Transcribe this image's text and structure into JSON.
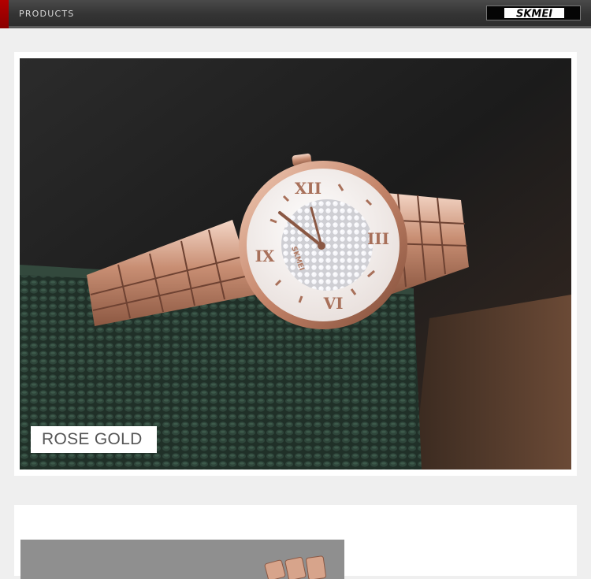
{
  "header": {
    "title": "PRODUCTS",
    "brand": "SKMEI"
  },
  "product_photo": {
    "subject": "rose gold women's watch with crystal dial on green fabric box",
    "color_label": "ROSE GOLD",
    "dial_brand": "SKMEI"
  },
  "colors": {
    "header_bg": "#333333",
    "accent": "#a00000",
    "page_bg": "#efefef",
    "rose_gold": "#d9a58c",
    "box_green": "#263a31"
  }
}
